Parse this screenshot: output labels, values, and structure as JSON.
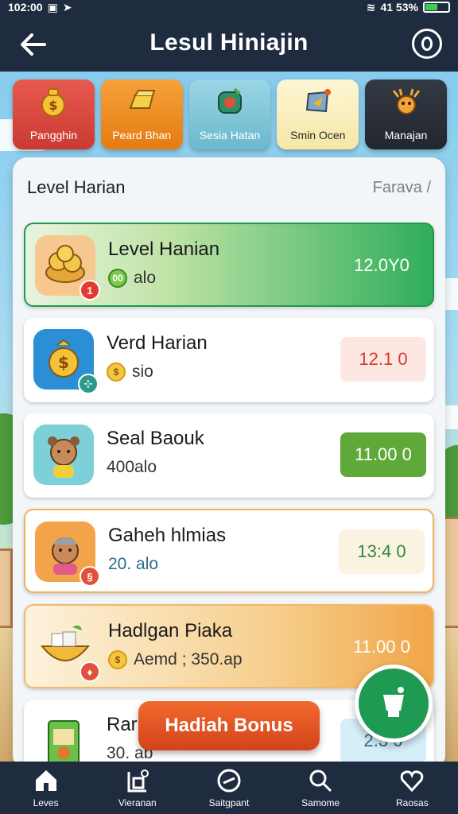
{
  "status_bar": {
    "time": "102:00",
    "battery": "41 53%",
    "battery_level": 0.53
  },
  "header": {
    "title": "Lesul Hiniajin"
  },
  "tabs": [
    {
      "label": "Pangghin",
      "icon": "money-bag-icon",
      "bg": "#e0463d"
    },
    {
      "label": "Peard Bhan",
      "icon": "gold-bar-icon",
      "bg": "#f28a1c"
    },
    {
      "label": "Sesia Hatan",
      "icon": "gem-icon",
      "bg": "#7fc7d9"
    },
    {
      "label": "Smin Ocen",
      "icon": "compass-icon",
      "bg": "#fbf1c2"
    },
    {
      "label": "Manajan",
      "icon": "deer-icon",
      "bg": "#2a2f38"
    }
  ],
  "panel": {
    "title": "Level Harian",
    "link": "Farava /"
  },
  "cards": [
    {
      "title": "Level Hanian",
      "sub": "alo",
      "value": "12.0Y0",
      "badge": "1"
    },
    {
      "title": "Verd Harian",
      "sub": "sio",
      "value": "12.1 0",
      "badge": ""
    },
    {
      "title": "Seal Baouk",
      "sub": "400alo",
      "value": "11.00 0",
      "badge": ""
    },
    {
      "title": "Gaheh hlmias",
      "sub": "20. alo",
      "value": "13:4 0",
      "badge": ""
    },
    {
      "title": "Hadlgan Piaka",
      "sub": "Aemd ; 350.ap",
      "value": "11.00 0",
      "badge": ""
    },
    {
      "title": "Rar",
      "sub": "30. ab",
      "value": "2.3 0",
      "badge": ""
    }
  ],
  "bonus_button": "Hadiah Bonus",
  "bottom_nav": [
    {
      "label": "Leves",
      "icon": "home-icon"
    },
    {
      "label": "Vieranan",
      "icon": "shop-icon"
    },
    {
      "label": "Saitgpant",
      "icon": "compass-icon"
    },
    {
      "label": "Samome",
      "icon": "search-icon"
    },
    {
      "label": "Raosas",
      "icon": "heart-icon"
    }
  ]
}
